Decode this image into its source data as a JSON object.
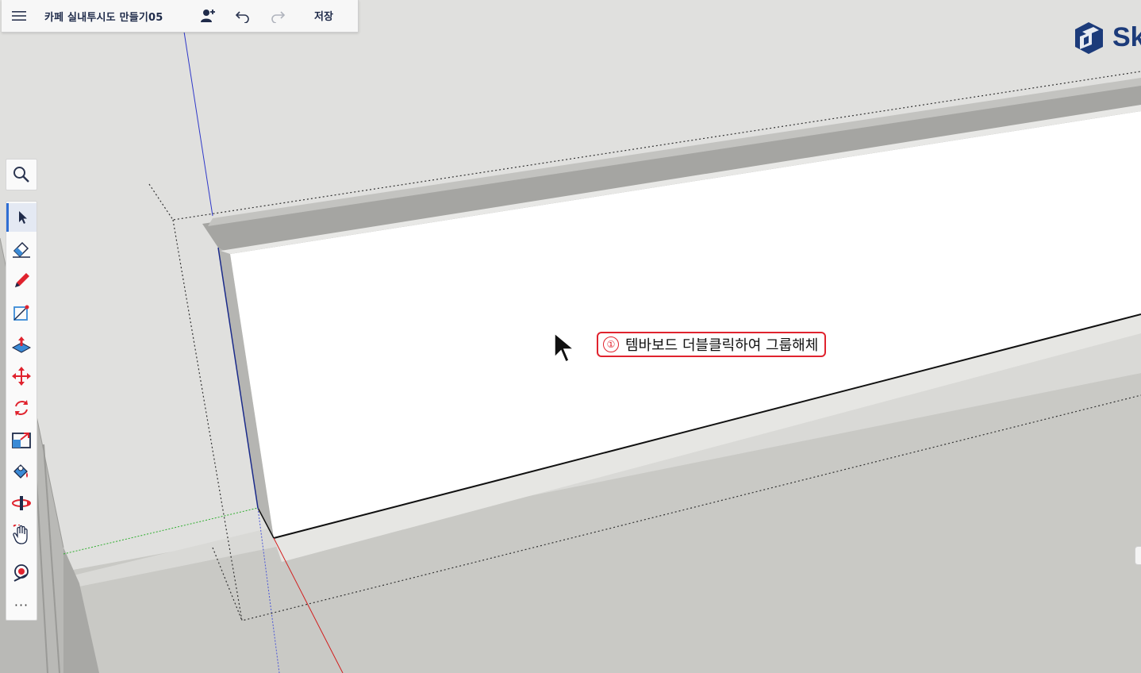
{
  "app": {
    "document_title": "카페 실내투시도 만들기05",
    "save_label": "저장",
    "logo_text": "Sk"
  },
  "toolbar": {
    "zoom": "search-icon",
    "tools": [
      {
        "name": "select-tool",
        "icon": "arrow-cursor-icon",
        "active": true
      },
      {
        "name": "eraser-tool",
        "icon": "eraser-icon"
      },
      {
        "name": "pencil-tool",
        "icon": "pencil-icon"
      },
      {
        "name": "rectangle-tool",
        "icon": "rectangle-icon"
      },
      {
        "name": "push-pull-tool",
        "icon": "push-pull-icon"
      },
      {
        "name": "move-tool",
        "icon": "move-arrows-icon"
      },
      {
        "name": "rotate-tool",
        "icon": "rotate-icon"
      },
      {
        "name": "scale-tool",
        "icon": "scale-icon"
      },
      {
        "name": "paint-tool",
        "icon": "paint-bucket-icon"
      },
      {
        "name": "orbit-tool",
        "icon": "orbit-icon"
      },
      {
        "name": "pan-tool",
        "icon": "hand-icon"
      },
      {
        "name": "position-camera-tool",
        "icon": "camera-position-icon"
      }
    ],
    "more_label": "···"
  },
  "annotation": {
    "number": "①",
    "text": "템바보드 더블클릭하여 그룹해체"
  },
  "colors": {
    "accent": "#2f6ed3",
    "annotation_red": "#e0232e",
    "axis_red": "#d11e1e",
    "axis_green": "#2fae2f",
    "axis_blue": "#2f38c9"
  }
}
